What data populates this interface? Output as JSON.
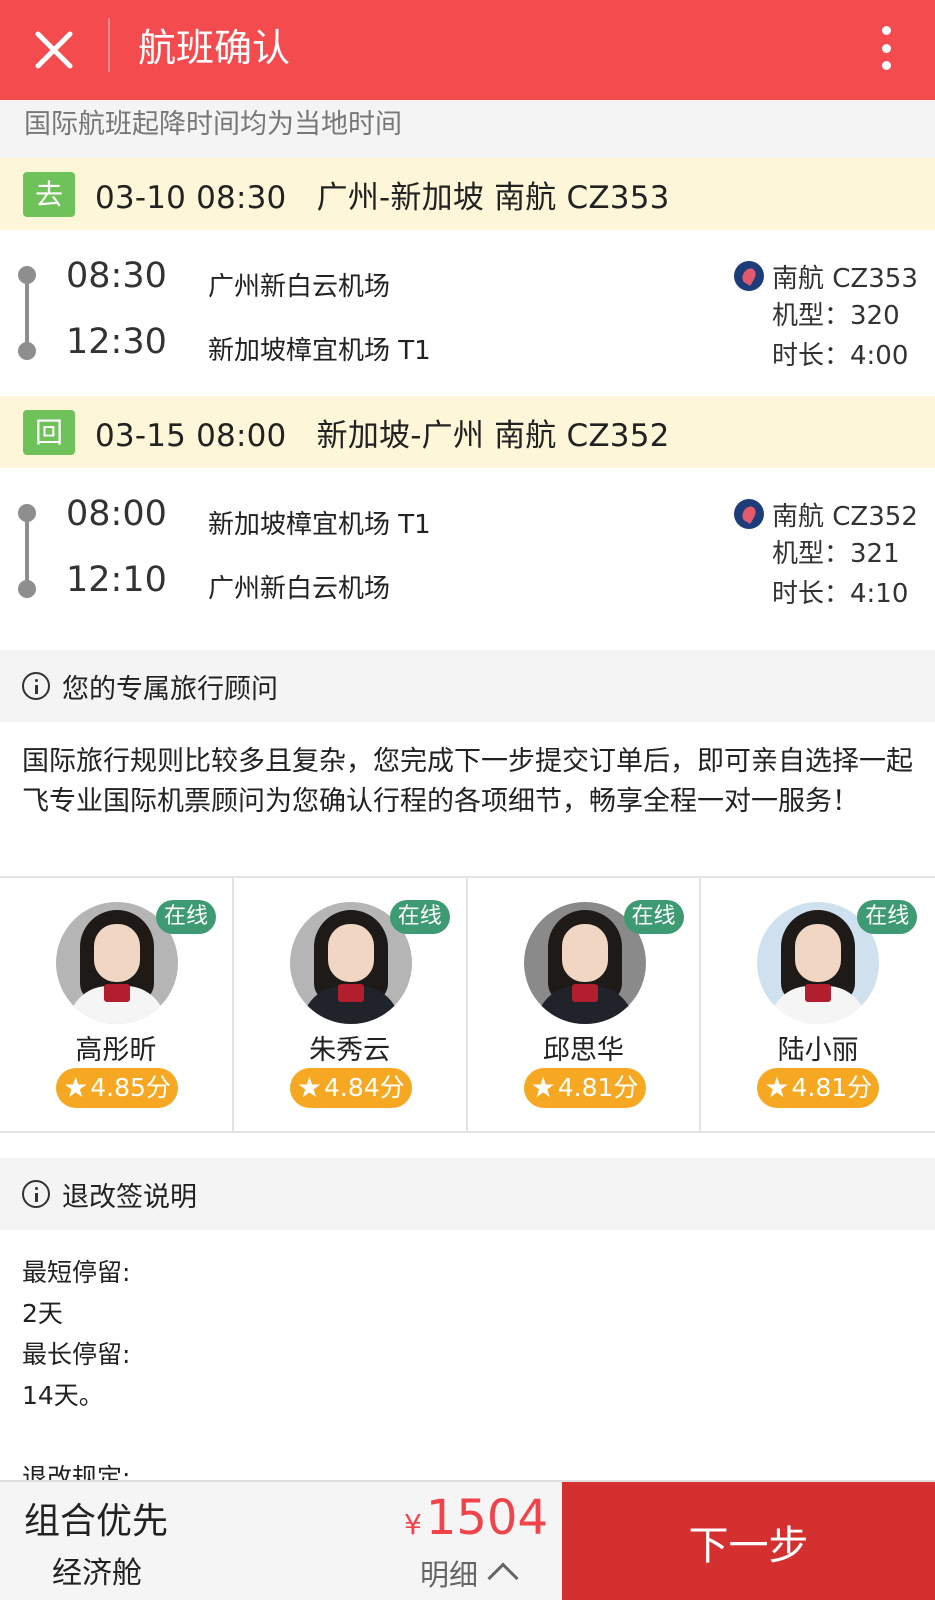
{
  "header": {
    "title": "航班确认",
    "close_icon": "close-icon",
    "more_icon": "more-vertical-icon",
    "color": "#f44b4f"
  },
  "notice": "国际航班起降时间均为当地时间",
  "segments": [
    {
      "tag": "去",
      "summary": "03-10 08:30   广州-新加坡 南航 CZ353",
      "dep_time": "08:30",
      "dep_airport": "广州新白云机场",
      "arr_time": "12:30",
      "arr_airport": "新加坡樟宜机场 T1",
      "airline": "南航 CZ353",
      "aircraft": "机型：320",
      "duration": "时长：4:00"
    },
    {
      "tag": "回",
      "summary": "03-15 08:00   新加坡-广州 南航 CZ352",
      "dep_time": "08:00",
      "dep_airport": "新加坡樟宜机场 T1",
      "arr_time": "12:10",
      "arr_airport": "广州新白云机场",
      "airline": "南航 CZ352",
      "aircraft": "机型：321",
      "duration": "时长：4:10"
    }
  ],
  "advisor_section": {
    "title": "您的专属旅行顾问",
    "description": "国际旅行规则比较多且复杂，您完成下一步提交订单后，即可亲自选择一起飞专业国际机票顾问为您确认行程的各项细节，畅享全程一对一服务！",
    "advisors": [
      {
        "name": "高彤昕",
        "status": "在线",
        "rating": "4.85分"
      },
      {
        "name": "朱秀云",
        "status": "在线",
        "rating": "4.84分"
      },
      {
        "name": "邱思华",
        "status": "在线",
        "rating": "4.81分"
      },
      {
        "name": "陆小丽",
        "status": "在线",
        "rating": "4.81分"
      }
    ]
  },
  "policy_section": {
    "title": "退改签说明",
    "lines": [
      "最短停留:",
      "2天",
      "最长停留:",
      "14天。",
      "",
      "退改规定:"
    ]
  },
  "bottom": {
    "fare_name": "组合优先",
    "cabin": "经济舱",
    "currency": "¥",
    "price": "1504",
    "detail_label": "明细",
    "next_label": "下一步"
  }
}
